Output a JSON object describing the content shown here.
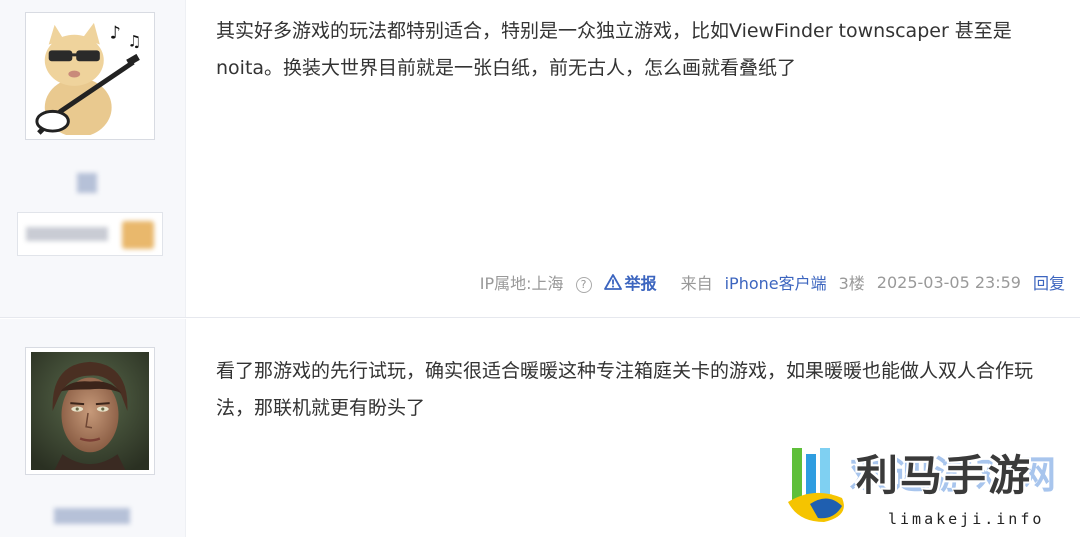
{
  "posts": [
    {
      "avatar": "cat-with-guitar-avatar",
      "content": "其实好多游戏的玩法都特别适合，特别是一众独立游戏，比如ViewFinder townscaper 甚至是 noita。换装大世界目前就是一张白纸，前无古人，怎么画就看叠纸了",
      "meta": {
        "ip": "IP属地:上海",
        "help_icon": "question-circle-icon",
        "report": "举报",
        "source_prefix": "来自",
        "source_link": "iPhone客户端",
        "floor": "3楼",
        "time": "2025-03-05 23:59",
        "reply": "回复"
      }
    },
    {
      "avatar": "painted-portrait-avatar",
      "content": "看了那游戏的先行试玩，确实很适合暖暖这种专注箱庭关卡的游戏，如果暖暖也能做人双人合作玩法，那联机就更有盼头了"
    }
  ],
  "watermark": {
    "title": "利马手游",
    "url": "limakeji.info"
  },
  "colors": {
    "link": "#3c65bf",
    "meta": "#999999",
    "sidebar_bg": "#f7f8fb",
    "text": "#333333"
  }
}
